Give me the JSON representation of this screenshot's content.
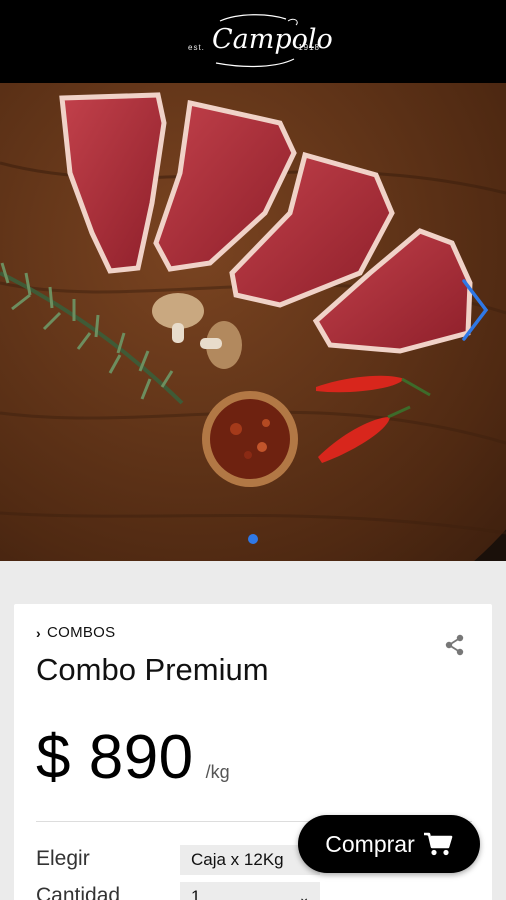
{
  "header": {
    "logo_name": "Campolo",
    "logo_est": "est.",
    "logo_year": "1918"
  },
  "carousel": {
    "slide_count": 1,
    "active_index": 0,
    "next_icon": "chevron-right-icon",
    "accent_color": "#2f78e6"
  },
  "product": {
    "category": "COMBOS",
    "name": "Combo Premium",
    "price": "$ 890",
    "unit": "/kg",
    "share_icon": "share-icon"
  },
  "options": {
    "elegir_label": "Elegir",
    "elegir_value": "Caja x 12Kg",
    "cantidad_label": "Cantidad",
    "cantidad_value": "1"
  },
  "actions": {
    "buy_label": "Comprar",
    "buy_icon": "cart-icon"
  }
}
